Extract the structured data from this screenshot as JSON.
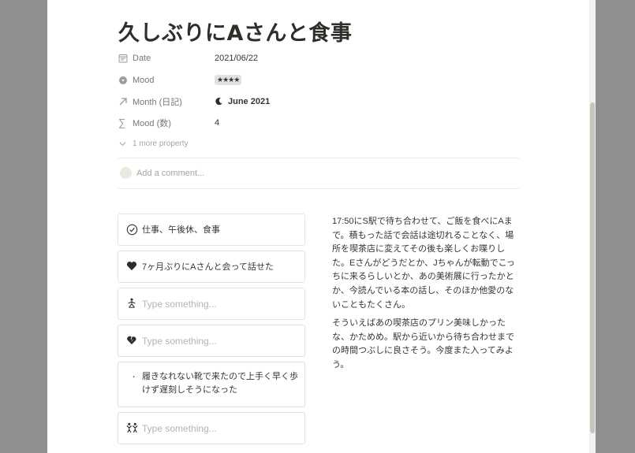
{
  "page": {
    "title": "久しぶりにAさんと食事"
  },
  "properties": [
    {
      "icon": "calendar-icon",
      "name": "Date",
      "value": "2021/06/22"
    },
    {
      "icon": "select-icon",
      "name": "Mood",
      "value": "★★★★"
    },
    {
      "icon": "relation-arrow-icon",
      "name": "Month (日記)",
      "value": "June 2021",
      "value_icon": "moon-icon"
    },
    {
      "icon": "sigma-icon",
      "name": "Mood (数)",
      "value": "4"
    }
  ],
  "more_property": "1 more property",
  "comment": {
    "placeholder": "Add a comment..."
  },
  "cards": [
    {
      "icon": "check-circle-icon",
      "text": "仕事、午後休、食事",
      "placeholder": false
    },
    {
      "icon": "heart-icon",
      "text": "7ヶ月ぶりにAさんと会って話せた",
      "placeholder": false
    },
    {
      "icon": "stick-figure-icon",
      "text": "Type something...",
      "placeholder": true
    },
    {
      "icon": "broken-heart-icon",
      "text": "Type something...",
      "placeholder": true
    },
    {
      "icon": "crescent-face-icon",
      "text": "履きなれない靴で来たので上手く早く歩けず遅刻しそうになった",
      "placeholder": false
    },
    {
      "icon": "people-icon",
      "text": "Type something...",
      "placeholder": true
    }
  ],
  "body": {
    "paragraphs": [
      "17:50にS駅で待ち合わせて、ご飯を食べにAまで。積もった話で会話は途切れることなく、場所を喫茶店に変えてその後も楽しくお喋りした。Eさんがどうだとか、Jちゃんが転動でこっちに来るらしいとか、あの美術展に行ったかとか、今読んでいる本の話し、そのほか他愛のないこともたくさん。",
      "そういえばあの喫茶店のプリン美味しかったな、かためめ。駅から近いから待ち合わせまでの時間つぶしに良さそう。今度また入ってみよう。"
    ]
  },
  "colors": {
    "backdrop": "#8f8f8f",
    "page": "#ffffff",
    "text": "#37352f",
    "muted": "#787774",
    "placeholder": "#b5b4b1"
  }
}
